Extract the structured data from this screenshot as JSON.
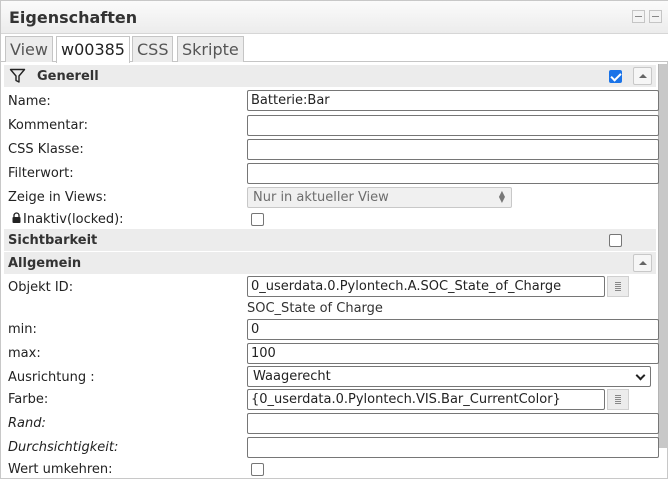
{
  "panel": {
    "title": "Eigenschaften"
  },
  "tabs": [
    {
      "label": "View"
    },
    {
      "label": "w00385"
    },
    {
      "label": "CSS"
    },
    {
      "label": "Skripte"
    }
  ],
  "generell": {
    "header": "Generell",
    "name_label": "Name:",
    "name_value": "Batterie:Bar",
    "kommentar_label": "Kommentar:",
    "css_klasse_label": "CSS Klasse:",
    "filterwort_label": "Filterwort:",
    "zeige_in_views_label": "Zeige in Views:",
    "zeige_in_views_value": "Nur in aktueller View",
    "inaktiv_label": "Inaktiv(locked):"
  },
  "sichtbarkeit": {
    "header": "Sichtbarkeit"
  },
  "allgemein": {
    "header": "Allgemein",
    "objekt_id_label": "Objekt ID:",
    "objekt_id_value": "0_userdata.0.Pylontech.A.SOC_State_of_Charge",
    "objekt_id_hint": "SOC_State of Charge",
    "min_label": "min:",
    "min_value": "0",
    "max_label": "max:",
    "max_value": "100",
    "ausrichtung_label": "Ausrichtung :",
    "ausrichtung_value": "Waagerecht",
    "farbe_label": "Farbe:",
    "farbe_value": "{0_userdata.0.Pylontech.VIS.Bar_CurrentColor}",
    "rand_label": "Rand:",
    "durchsichtigkeit_label": "Durchsichtigkeit:",
    "wert_umkehren_label": "Wert umkehren:"
  }
}
